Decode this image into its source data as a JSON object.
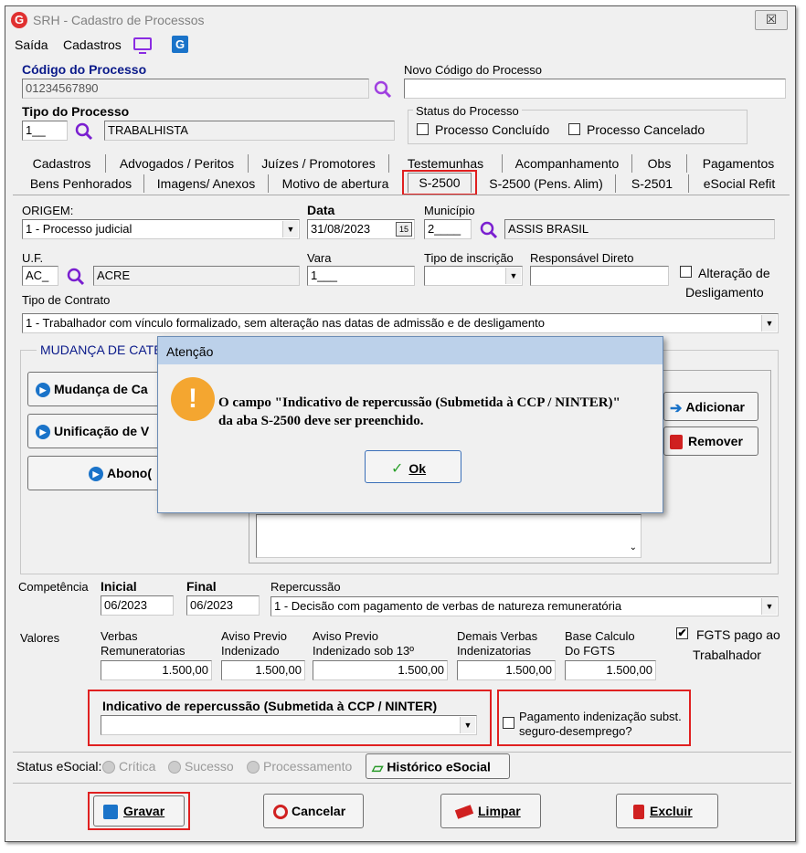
{
  "window": {
    "title": "SRH - Cadastro de Processos",
    "close": "☒"
  },
  "menu": {
    "saida": "Saída",
    "cadastros": "Cadastros"
  },
  "header": {
    "codigo_label": "Código do Processo",
    "codigo_value": "01234567890",
    "novo_codigo_label": "Novo Código do Processo",
    "novo_codigo_value": "",
    "tipo_label": "Tipo do Processo",
    "tipo_code": "1__",
    "tipo_name": "TRABALHISTA",
    "status_label": "Status do Processo",
    "concluido_label": "Processo Concluído",
    "cancelado_label": "Processo Cancelado"
  },
  "tabs_row1": [
    "Cadastros",
    "Advogados / Peritos",
    "Juízes / Promotores",
    "Testemunhas",
    "Acompanhamento",
    "Obs",
    "Pagamentos"
  ],
  "tabs_row2": [
    "Bens Penhorados",
    "Imagens/ Anexos",
    "Motivo de abertura",
    "S-2500",
    "S-2500 (Pens. Alim)",
    "S-2501",
    "eSocial Refit"
  ],
  "form": {
    "origem_label": "ORIGEM:",
    "origem_value": "1 - Processo judicial",
    "data_label": "Data",
    "data_value": "31/08/2023",
    "municipio_label": "Município",
    "municipio_code": "2____",
    "municipio_name": "ASSIS BRASIL",
    "uf_label": "U.F.",
    "uf_code": "AC_",
    "uf_name": "ACRE",
    "vara_label": "Vara",
    "vara_value": "1___",
    "tipo_inscricao_label": "Tipo de inscrição",
    "responsavel_label": "Responsável Direto",
    "alteracao_label_1": "Alteração de",
    "alteracao_label_2": "Desligamento",
    "tipo_contrato_label": "Tipo de Contrato",
    "tipo_contrato_value": "1 - Trabalhador com vínculo formalizado, sem alteração nas datas de admissão e de desligamento",
    "mudanca_group": "MUDANÇA DE CATE",
    "btn_mudanca": "Mudança de Ca",
    "btn_unificacao": "Unificação de V",
    "btn_abono": "Abono(",
    "btn_adicionar": "Adicionar",
    "btn_remover": "Remover"
  },
  "competencia": {
    "label": "Competência",
    "inicial_label": "Inicial",
    "inicial_value": "06/2023",
    "final_label": "Final",
    "final_value": "06/2023",
    "repercussao_label": "Repercussão",
    "repercussao_value": "1 - Decisão com pagamento de verbas de natureza remuneratória"
  },
  "valores": {
    "label": "Valores",
    "verbas_l1": "Verbas",
    "verbas_l2": "Remuneratorias",
    "verbas_value": "1.500,00",
    "aviso_l1": "Aviso Previo",
    "aviso_l2": "Indenizado",
    "aviso_value": "1.500,00",
    "aviso13_l1": "Aviso Previo",
    "aviso13_l2": "Indenizado sob 13º",
    "aviso13_value": "1.500,00",
    "demais_l1": "Demais Verbas",
    "demais_l2": "Indenizatorias",
    "demais_value": "1.500,00",
    "base_l1": "Base Calculo",
    "base_l2": "Do FGTS",
    "base_value": "1.500,00",
    "fgts_l1": "FGTS pago ao",
    "fgts_l2": "Trabalhador"
  },
  "indicativo": {
    "label": "Indicativo de repercussão (Submetida à CCP / NINTER)",
    "value": "",
    "pagamento_l1": "Pagamento indenização subst.",
    "pagamento_l2": "seguro-desemprego?"
  },
  "status_esocial": {
    "label": "Status eSocial:",
    "critica": "Crítica",
    "sucesso": "Sucesso",
    "processamento": "Processamento",
    "historico": "Histórico eSocial"
  },
  "buttons": {
    "gravar": "Gravar",
    "cancelar": "Cancelar",
    "limpar": "Limpar",
    "excluir": "Excluir"
  },
  "dialog": {
    "title": "Atenção",
    "line1": "O campo \"Indicativo de repercussão (Submetida à CCP / NINTER)\"",
    "line2": "da aba S-2500 deve ser preenchido.",
    "ok": "Ok"
  },
  "colors": {
    "accent_red": "#e02020",
    "link_blue": "#1a73c9",
    "dialog_title": "#bcd1ea"
  }
}
